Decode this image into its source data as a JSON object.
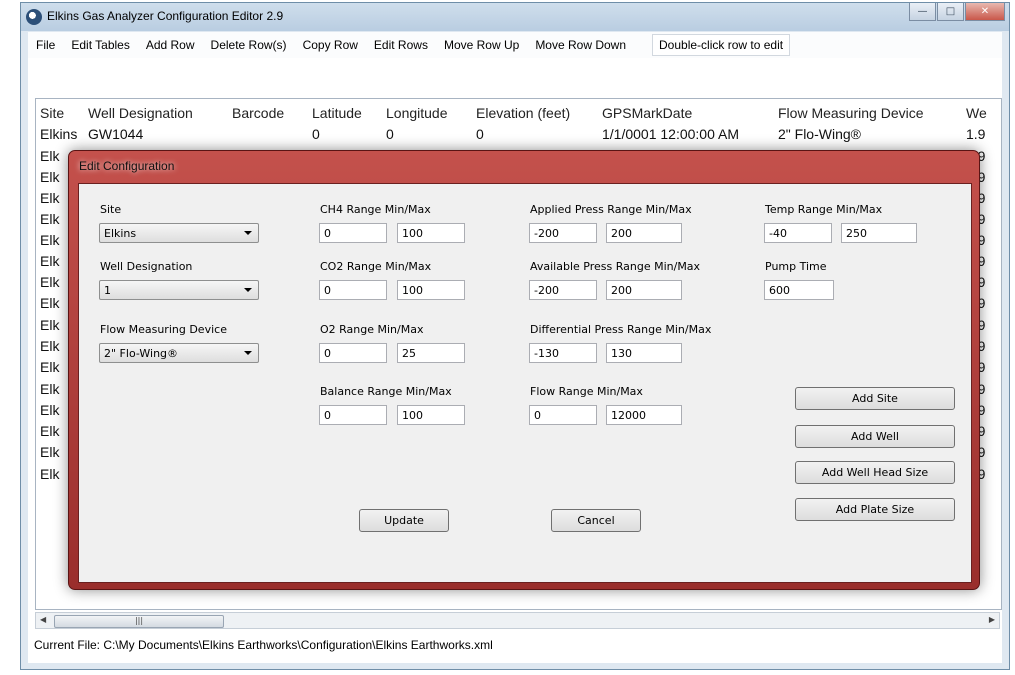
{
  "window": {
    "title": "Elkins Gas Analyzer Configuration Editor 2.9"
  },
  "menu": {
    "items": [
      "File",
      "Edit Tables",
      "Add Row",
      "Delete Row(s)",
      "Copy Row",
      "Edit Rows",
      "Move Row Up",
      "Move Row Down"
    ],
    "hint": "Double-click row to edit"
  },
  "grid": {
    "columns": [
      "Site",
      "Well Designation",
      "Barcode",
      "Latitude",
      "Longitude",
      "Elevation (feet)",
      "GPSMarkDate",
      "Flow Measuring Device",
      "We"
    ],
    "first_row": {
      "site": "Elkins",
      "well": "GW1044",
      "lat": "0",
      "lon": "0",
      "elev": "0",
      "date": "1/1/0001 12:00:00 AM",
      "device": "2\" Flo-Wing®",
      "we": "1.9"
    },
    "site_stub": "Elk",
    "we_stub": "1.9"
  },
  "status": {
    "current_file": "Current File:  C:\\My Documents\\Elkins Earthworks\\Configuration\\Elkins Earthworks.xml"
  },
  "dialog": {
    "title": "Edit Configuration",
    "site": {
      "label": "Site",
      "value": "Elkins"
    },
    "well": {
      "label": "Well Designation",
      "value": "1"
    },
    "device": {
      "label": "Flow Measuring Device",
      "value": "2\" Flo-Wing®"
    },
    "ch4": {
      "label": "CH4 Range Min/Max",
      "min": "0",
      "max": "100"
    },
    "co2": {
      "label": "CO2 Range Min/Max",
      "min": "0",
      "max": "100"
    },
    "o2": {
      "label": "O2 Range Min/Max",
      "min": "0",
      "max": "25"
    },
    "balance": {
      "label": "Balance Range Min/Max",
      "min": "0",
      "max": "100"
    },
    "applied": {
      "label": "Applied Press Range Min/Max",
      "min": "-200",
      "max": "200"
    },
    "available": {
      "label": "Available Press Range Min/Max",
      "min": "-200",
      "max": "200"
    },
    "differential": {
      "label": "Differential Press Range Min/Max",
      "min": "-130",
      "max": "130"
    },
    "flow": {
      "label": "Flow Range Min/Max",
      "min": "0",
      "max": "12000"
    },
    "temp": {
      "label": "Temp Range Min/Max",
      "min": "-40",
      "max": "250"
    },
    "pump": {
      "label": "Pump Time",
      "value": "600"
    },
    "buttons": {
      "update": "Update",
      "cancel": "Cancel",
      "add_site": "Add Site",
      "add_well": "Add Well",
      "add_well_head": "Add Well Head Size",
      "add_plate": "Add Plate Size"
    }
  }
}
